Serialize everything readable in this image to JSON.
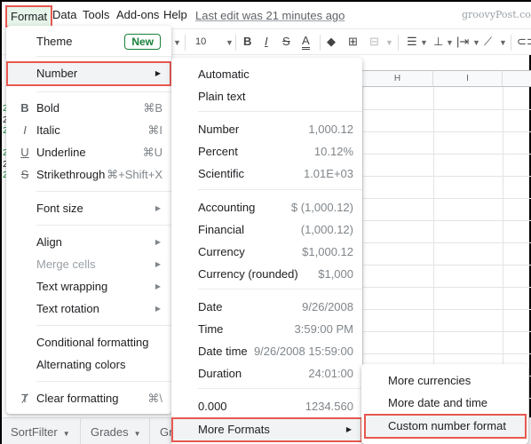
{
  "menubar": {
    "items": [
      "Format",
      "Data",
      "Tools",
      "Add-ons",
      "Help"
    ],
    "last_edit": "Last edit was 21 minutes ago",
    "brand": "groovyPost.com"
  },
  "toolbar": {
    "font_size": "10",
    "bold": "B",
    "italic": "I",
    "strike": "S",
    "text_color": "A"
  },
  "grid": {
    "columns": [
      "H",
      "I",
      ""
    ]
  },
  "sheet_tabs": [
    "SortFilter",
    "Grades",
    "Gr"
  ],
  "format_menu": {
    "theme": {
      "label": "Theme",
      "badge": "New"
    },
    "number": {
      "label": "Number"
    },
    "bold": {
      "label": "Bold",
      "shortcut": "⌘B"
    },
    "italic": {
      "label": "Italic",
      "shortcut": "⌘I"
    },
    "underline": {
      "label": "Underline",
      "shortcut": "⌘U"
    },
    "strikethrough": {
      "label": "Strikethrough",
      "shortcut": "⌘+Shift+X"
    },
    "font_size": {
      "label": "Font size"
    },
    "align": {
      "label": "Align"
    },
    "merge_cells": {
      "label": "Merge cells",
      "disabled": true
    },
    "text_wrapping": {
      "label": "Text wrapping"
    },
    "text_rotation": {
      "label": "Text rotation"
    },
    "conditional_formatting": {
      "label": "Conditional formatting"
    },
    "alternating_colors": {
      "label": "Alternating colors"
    },
    "clear_formatting": {
      "label": "Clear formatting",
      "shortcut": "⌘\\"
    }
  },
  "number_menu": {
    "items": [
      {
        "label": "Automatic",
        "example": ""
      },
      {
        "label": "Plain text",
        "example": ""
      },
      {
        "label": "Number",
        "example": "1,000.12"
      },
      {
        "label": "Percent",
        "example": "10.12%"
      },
      {
        "label": "Scientific",
        "example": "1.01E+03"
      },
      {
        "label": "Accounting",
        "example": "$ (1,000.12)"
      },
      {
        "label": "Financial",
        "example": "(1,000.12)"
      },
      {
        "label": "Currency",
        "example": "$1,000.12"
      },
      {
        "label": "Currency (rounded)",
        "example": "$1,000"
      },
      {
        "label": "Date",
        "example": "9/26/2008"
      },
      {
        "label": "Time",
        "example": "3:59:00 PM"
      },
      {
        "label": "Date time",
        "example": "9/26/2008 15:59:00"
      },
      {
        "label": "Duration",
        "example": "24:01:00"
      },
      {
        "label": "0.000",
        "example": "1234.560"
      }
    ],
    "more_formats": "More Formats"
  },
  "more_formats_menu": {
    "items": [
      "More currencies",
      "More date and time formats",
      "Custom number format"
    ]
  },
  "colors": {
    "highlight_border": "#e8584f",
    "new_badge": "#188038"
  }
}
